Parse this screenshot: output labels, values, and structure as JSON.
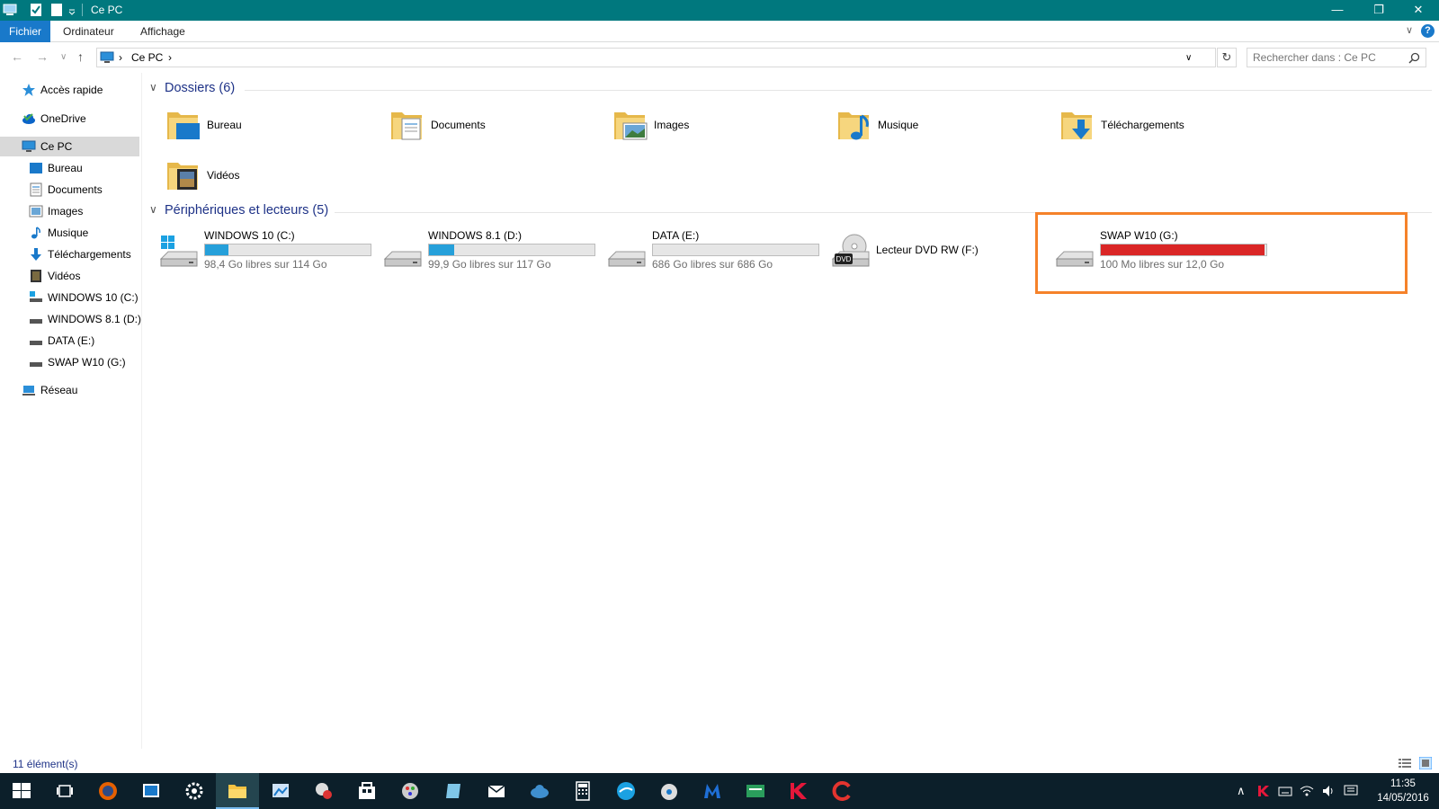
{
  "window": {
    "title": "Ce PC",
    "minimize_glyph": "—",
    "restore_glyph": "❐",
    "close_glyph": "✕"
  },
  "ribbon": {
    "tabs": [
      "Fichier",
      "Ordinateur",
      "Affichage"
    ],
    "expand_glyph": "∨",
    "help_glyph": "?"
  },
  "navigation": {
    "back_glyph": "←",
    "forward_glyph": "→",
    "recent_glyph": "∨",
    "up_glyph": "↑"
  },
  "address": {
    "crumbs": [
      "Ce PC"
    ],
    "separator": "›",
    "dropdown_glyph": "∨",
    "refresh_glyph": "↻"
  },
  "search": {
    "placeholder": "Rechercher dans : Ce PC",
    "icon": "search-icon"
  },
  "sidebar": {
    "items": [
      {
        "label": "Accès rapide",
        "icon": "star-icon"
      },
      {
        "label": "OneDrive",
        "icon": "cloud-icon"
      },
      {
        "label": "Ce PC",
        "icon": "computer-icon"
      },
      {
        "label": "Bureau",
        "icon": "desktop-icon"
      },
      {
        "label": "Documents",
        "icon": "document-icon"
      },
      {
        "label": "Images",
        "icon": "image-icon"
      },
      {
        "label": "Musique",
        "icon": "music-icon"
      },
      {
        "label": "Téléchargements",
        "icon": "download-icon"
      },
      {
        "label": "Vidéos",
        "icon": "video-icon"
      },
      {
        "label": "WINDOWS  10 (C:)",
        "icon": "drive-icon"
      },
      {
        "label": "WINDOWS  8.1 (D:)",
        "icon": "drive-icon"
      },
      {
        "label": "DATA (E:)",
        "icon": "drive-icon"
      },
      {
        "label": "SWAP  W10 (G:)",
        "icon": "drive-icon"
      },
      {
        "label": "Réseau",
        "icon": "network-icon"
      }
    ]
  },
  "folders": {
    "header": "Dossiers (6)",
    "items": [
      {
        "label": "Bureau",
        "icon": "desktop-folder-icon"
      },
      {
        "label": "Documents",
        "icon": "documents-folder-icon"
      },
      {
        "label": "Images",
        "icon": "images-folder-icon"
      },
      {
        "label": "Musique",
        "icon": "music-folder-icon"
      },
      {
        "label": "Téléchargements",
        "icon": "downloads-folder-icon"
      },
      {
        "label": "Vidéos",
        "icon": "videos-folder-icon"
      }
    ]
  },
  "drives": {
    "header": "Périphériques et lecteurs (5)",
    "items": [
      {
        "label": "WINDOWS  10 (C:)",
        "free": "98,4 Go libres sur 114 Go",
        "used_fraction": 0.14,
        "bar_color": "#26a0da",
        "has_bar": true
      },
      {
        "label": "WINDOWS  8.1 (D:)",
        "free": "99,9 Go libres sur 117 Go",
        "used_fraction": 0.15,
        "bar_color": "#26a0da",
        "has_bar": true
      },
      {
        "label": "DATA (E:)",
        "free": "686 Go libres sur 686 Go",
        "used_fraction": 0.0,
        "bar_color": "#26a0da",
        "has_bar": true
      },
      {
        "label": "Lecteur DVD RW (F:)",
        "free": "",
        "used_fraction": 0.0,
        "bar_color": "",
        "has_bar": false
      },
      {
        "label": "SWAP  W10 (G:)",
        "free": "100 Mo libres sur 12,0 Go",
        "used_fraction": 0.99,
        "bar_color": "#da2626",
        "has_bar": true
      }
    ],
    "dvd_badge": "DVD"
  },
  "status": {
    "count": "11 élément(s)"
  },
  "taskbar": {
    "time": "11:35",
    "date": "14/05/2016",
    "apps": [
      "start-icon",
      "task-view-icon",
      "firefox-icon",
      "app-icon",
      "settings-icon",
      "file-explorer-icon",
      "app-icon",
      "app-icon",
      "store-icon",
      "app-icon",
      "app-icon",
      "mail-icon",
      "cloud-icon",
      "calculator-icon",
      "app-icon",
      "app-icon",
      "malwarebytes-icon",
      "app-icon",
      "kaspersky-icon",
      "ccleaner-icon"
    ]
  },
  "colors": {
    "titlebar": "#00787e",
    "accent": "#1979ca",
    "bar_ok": "#26a0da",
    "bar_full": "#da2626",
    "highlight": "#f5822a"
  }
}
